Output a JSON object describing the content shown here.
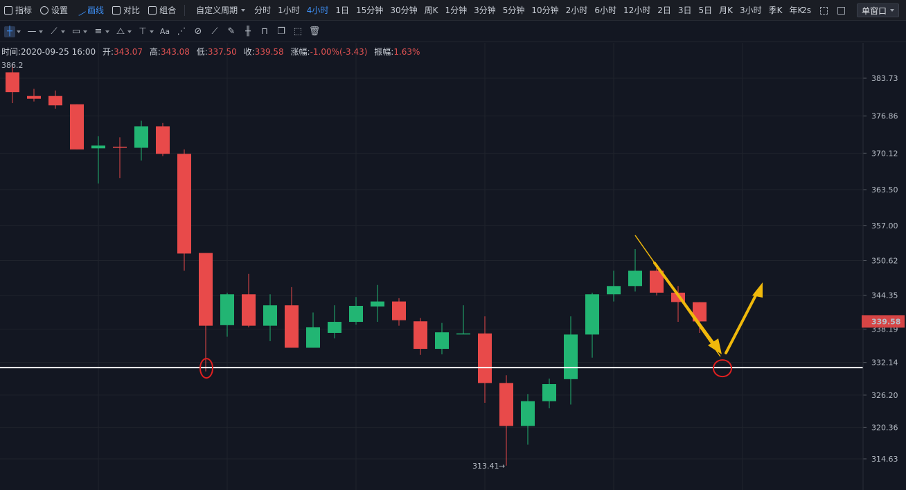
{
  "toolbar": {
    "indicator": "指标",
    "settings": "设置",
    "draw": "画线",
    "compare": "对比",
    "combine": "组合",
    "custom_period": "自定义周期",
    "periods": [
      "分时",
      "1小时",
      "4小时",
      "1日",
      "15分钟",
      "30分钟",
      "周K",
      "1分钟",
      "3分钟",
      "5分钟",
      "10分钟",
      "2小时",
      "6小时",
      "12小时",
      "2日",
      "3日",
      "5日",
      "月K",
      "3小时",
      "季K",
      "年K"
    ],
    "active_period": "4小时",
    "refresh": "2s",
    "window_mode": "单窗口"
  },
  "drawing_tools": [
    "crosshair",
    "horizontal-line",
    "trend-line",
    "rectangle",
    "parallel-lines",
    "pattern",
    "measure",
    "text",
    "fib-retracement",
    "magnet",
    "ruler",
    "brush",
    "chart-type",
    "lock",
    "copy",
    "screenshot",
    "trash"
  ],
  "info": {
    "time_label": "时间:",
    "time": "2020-09-25 16:00",
    "open_label": "开:",
    "open": "343.07",
    "high_label": "高:",
    "high": "343.08",
    "low_label": "低:",
    "low": "337.50",
    "close_label": "收:",
    "close": "339.58",
    "change_label": "涨幅:",
    "change": "-1.00%(-3.43)",
    "amp_label": "振幅:",
    "amp": "1.63%"
  },
  "colors": {
    "up": "#22b573",
    "down": "#e84a4a",
    "bg": "#131722",
    "grid": "#1f232c",
    "support": "#ffffff",
    "arrow": "#f0b90b",
    "marker": "#e02020",
    "price_tag": "#d64545"
  },
  "chart_data": {
    "type": "candlestick",
    "ylim": [
      311.0,
      388.5
    ],
    "y_ticks": [
      "383.73",
      "376.86",
      "370.12",
      "363.50",
      "357.00",
      "350.62",
      "344.35",
      "338.19",
      "332.14",
      "326.20",
      "320.36",
      "314.63"
    ],
    "max_label": "386.2",
    "min_label": "313.41",
    "current_price": "339.58",
    "support_level": 331.2,
    "candles": [
      {
        "o": 384.8,
        "h": 386.2,
        "l": 379.2,
        "c": 381.2
      },
      {
        "o": 380.5,
        "h": 381.8,
        "l": 379.5,
        "c": 380.0
      },
      {
        "o": 380.5,
        "h": 381.5,
        "l": 378.2,
        "c": 378.8
      },
      {
        "o": 379.0,
        "h": 379.0,
        "l": 370.8,
        "c": 370.8
      },
      {
        "o": 371.0,
        "h": 373.2,
        "l": 364.6,
        "c": 371.5
      },
      {
        "o": 371.3,
        "h": 373.0,
        "l": 365.6,
        "c": 371.1
      },
      {
        "o": 371.1,
        "h": 376.0,
        "l": 368.8,
        "c": 375.0
      },
      {
        "o": 375.0,
        "h": 375.6,
        "l": 369.6,
        "c": 370.0
      },
      {
        "o": 370.0,
        "h": 370.8,
        "l": 348.8,
        "c": 351.9
      },
      {
        "o": 352.0,
        "h": 352.0,
        "l": 330.5,
        "c": 338.8
      },
      {
        "o": 338.9,
        "h": 344.8,
        "l": 336.8,
        "c": 344.5
      },
      {
        "o": 344.5,
        "h": 348.2,
        "l": 338.5,
        "c": 338.8
      },
      {
        "o": 338.8,
        "h": 344.5,
        "l": 336.0,
        "c": 342.5
      },
      {
        "o": 342.5,
        "h": 345.8,
        "l": 334.8,
        "c": 334.8
      },
      {
        "o": 334.8,
        "h": 341.2,
        "l": 334.8,
        "c": 338.5
      },
      {
        "o": 337.5,
        "h": 342.5,
        "l": 336.5,
        "c": 339.5
      },
      {
        "o": 339.5,
        "h": 344.0,
        "l": 339.0,
        "c": 342.4
      },
      {
        "o": 342.3,
        "h": 346.2,
        "l": 339.5,
        "c": 343.2
      },
      {
        "o": 343.2,
        "h": 343.8,
        "l": 338.8,
        "c": 339.8
      },
      {
        "o": 339.6,
        "h": 340.2,
        "l": 333.5,
        "c": 334.6
      },
      {
        "o": 334.6,
        "h": 339.3,
        "l": 333.6,
        "c": 337.6
      },
      {
        "o": 337.3,
        "h": 342.5,
        "l": 337.3,
        "c": 337.4
      },
      {
        "o": 337.4,
        "h": 340.5,
        "l": 324.8,
        "c": 328.4
      },
      {
        "o": 328.4,
        "h": 329.8,
        "l": 313.41,
        "c": 320.6
      },
      {
        "o": 320.6,
        "h": 326.4,
        "l": 317.2,
        "c": 325.1
      },
      {
        "o": 325.1,
        "h": 329.2,
        "l": 323.8,
        "c": 328.2
      },
      {
        "o": 329.1,
        "h": 340.5,
        "l": 324.5,
        "c": 337.2
      },
      {
        "o": 337.2,
        "h": 344.8,
        "l": 333.0,
        "c": 344.5
      },
      {
        "o": 344.5,
        "h": 348.8,
        "l": 343.2,
        "c": 346.0
      },
      {
        "o": 346.0,
        "h": 352.7,
        "l": 345.0,
        "c": 348.8
      },
      {
        "o": 348.8,
        "h": 349.8,
        "l": 344.3,
        "c": 344.8
      },
      {
        "o": 344.8,
        "h": 346.0,
        "l": 339.5,
        "c": 343.1
      },
      {
        "o": 343.07,
        "h": 343.08,
        "l": 337.5,
        "c": 339.58
      }
    ]
  }
}
